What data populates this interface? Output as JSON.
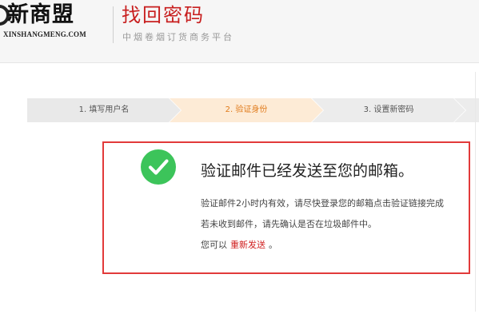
{
  "header": {
    "logo_text": "新商盟",
    "logo_sub": "XINSHANGMENG.COM",
    "title": "找回密码",
    "subtitle": "中烟卷烟订货商务平台"
  },
  "steps": [
    {
      "label": "1. 填写用户名",
      "state": "done"
    },
    {
      "label": "2. 验证身份",
      "state": "active"
    },
    {
      "label": "3. 设置新密码",
      "state": "pending"
    },
    {
      "label": "",
      "state": "pending"
    }
  ],
  "message": {
    "icon": "check-circle-icon",
    "title": "验证邮件已经发送至您的邮箱。",
    "line1": "验证邮件2小时内有效，请尽快登录您的邮箱点击验证链接完成",
    "line2": "若未收到邮件，请先确认是否在垃圾邮件中。",
    "line3_prefix": "您可以",
    "resend_label": "重新发送",
    "line3_suffix": "。"
  },
  "colors": {
    "brand_red": "#c81f1f",
    "step_active_bg": "#fdebd6",
    "step_active_text": "#e07a1a",
    "success_green": "#3cc45a",
    "box_border": "#e23a3a"
  }
}
